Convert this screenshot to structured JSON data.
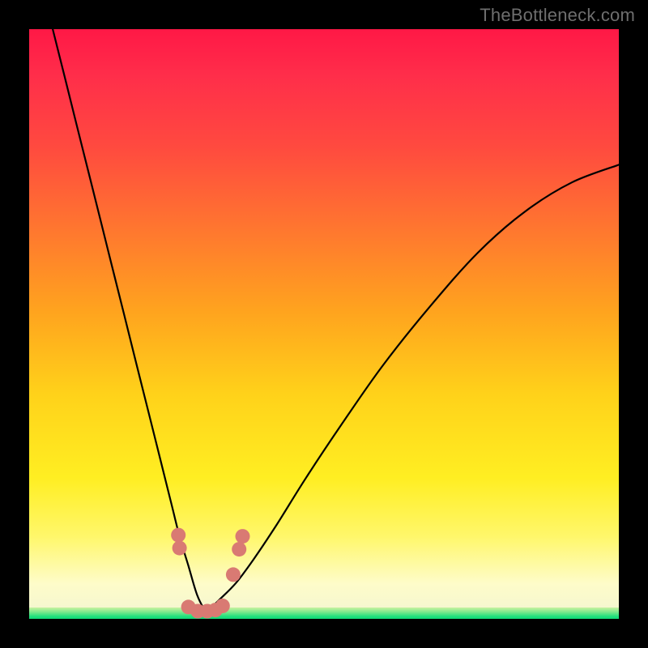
{
  "watermark": "TheBottleneck.com",
  "chart_data": {
    "type": "line",
    "title": "",
    "xlabel": "",
    "ylabel": "",
    "ylim": [
      0,
      100
    ],
    "xlim": [
      0,
      100
    ],
    "notes": "Bottleneck-style V curve. Vertical axis ≈ bottleneck % (top ≈ 100%, bottom ≈ 0%). Minimum at x ≈ 30 where curve touches the green band (~0–2%). Background gradient red→yellow→green encodes severity.",
    "series": [
      {
        "name": "left-branch",
        "x": [
          4,
          6,
          8,
          10,
          12,
          14,
          16,
          18,
          20,
          22,
          24,
          25.5,
          27,
          28.5,
          30
        ],
        "values": [
          100,
          92,
          84,
          76,
          68,
          60,
          52,
          44,
          36,
          28,
          20,
          14,
          9,
          4,
          1
        ]
      },
      {
        "name": "right-branch",
        "x": [
          30,
          32,
          35,
          38,
          42,
          47,
          53,
          60,
          68,
          76,
          84,
          92,
          100
        ],
        "values": [
          1,
          3,
          6,
          10,
          16,
          24,
          33,
          43,
          53,
          62,
          69,
          74,
          77
        ]
      }
    ],
    "markers": {
      "name": "salmon-dots",
      "x": [
        25.3,
        25.5,
        27.0,
        28.6,
        30.2,
        31.6,
        32.8,
        34.6,
        35.6,
        36.2
      ],
      "values": [
        14.2,
        12.0,
        2.0,
        1.3,
        1.3,
        1.5,
        2.2,
        7.5,
        11.8,
        14.0
      ]
    },
    "green_band_pct": 2
  }
}
